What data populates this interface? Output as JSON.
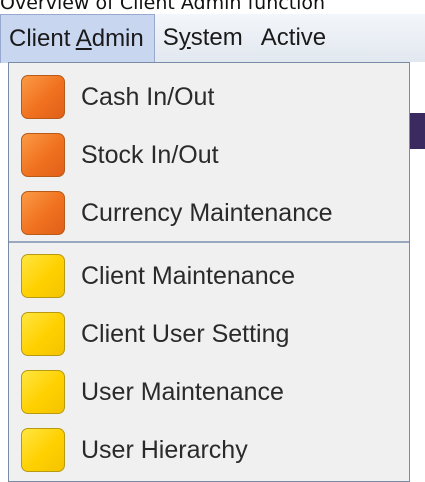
{
  "caption": "Overview of Client Admin function",
  "menubar": {
    "items": [
      {
        "before": "Client ",
        "mnemonic": "A",
        "after": "dmin"
      },
      {
        "before": "S",
        "mnemonic": "y",
        "after": "stem"
      },
      {
        "before": "Active",
        "mnemonic": "",
        "after": ""
      }
    ]
  },
  "dropdown": {
    "items": [
      {
        "label": "Cash In/Out",
        "icon": "orange-square-icon",
        "color": "#f07a24"
      },
      {
        "label": "Stock In/Out",
        "icon": "orange-square-icon",
        "color": "#f07a24"
      },
      {
        "label": "Currency Maintenance",
        "icon": "orange-square-icon",
        "color": "#f07a24"
      },
      {
        "label": "Client Maintenance",
        "icon": "yellow-square-icon",
        "color": "#ffd400"
      },
      {
        "label": "Client User Setting",
        "icon": "yellow-square-icon",
        "color": "#ffd400"
      },
      {
        "label": "User Maintenance",
        "icon": "yellow-square-icon",
        "color": "#ffd400"
      },
      {
        "label": "User Hierarchy",
        "icon": "yellow-square-icon",
        "color": "#ffd400"
      }
    ]
  }
}
